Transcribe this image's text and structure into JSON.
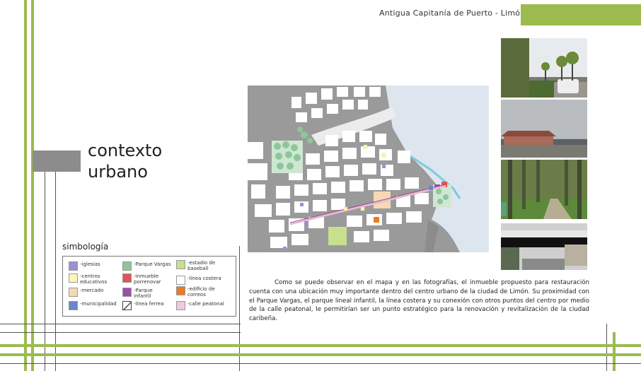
{
  "header": {
    "title": "Antigua Capitanía de Puerto - Limón"
  },
  "section": {
    "title_line1": "contexto",
    "title_line2": "urbano"
  },
  "legend": {
    "title": "simbología",
    "items": [
      {
        "label": "-iglesias",
        "color": "#9b8fd6"
      },
      {
        "label": "-centros educativos",
        "color": "#fbf6b8"
      },
      {
        "label": "-mercado",
        "color": "#f6d8b4"
      },
      {
        "label": "-municipalidad",
        "color": "#6a86d0"
      },
      {
        "label": "-Parque Vargas",
        "color": "#8cc79a"
      },
      {
        "label": "-inmueble porrenovar",
        "color": "#e05555"
      },
      {
        "label": "-Parque infantil",
        "color": "#9b4fa8"
      },
      {
        "label": "-línea ferrea",
        "color": "#ffffff"
      },
      {
        "label": "-estadio de baseball",
        "color": "#c6e08e"
      },
      {
        "label": "-línea costera",
        "color": "#ffffff"
      },
      {
        "label": "-edificio de correos",
        "color": "#e87d22"
      },
      {
        "label": "-calle peatonal",
        "color": "#f2c8e0"
      }
    ]
  },
  "body_text": "Como se puede observar en el mapa y en las fotografías, el inmueble propuesto para restauración cuenta con una ubicación muy importante dentro del centro urbano de la ciudad de Limón. Su proximidad con el Parque Vargas, el parque lineal infantil, la línea costera y su conexión con otros puntos del centro por medio de la calle peatonal, le permitirían ser un punto estratégico para la renovación y revitalización de la ciudad caribeña.",
  "colors": {
    "accent_green": "#9bbb4f",
    "map_street": "#9a9a9a",
    "map_block": "#ffffff",
    "map_sea": "#dde6ef"
  }
}
